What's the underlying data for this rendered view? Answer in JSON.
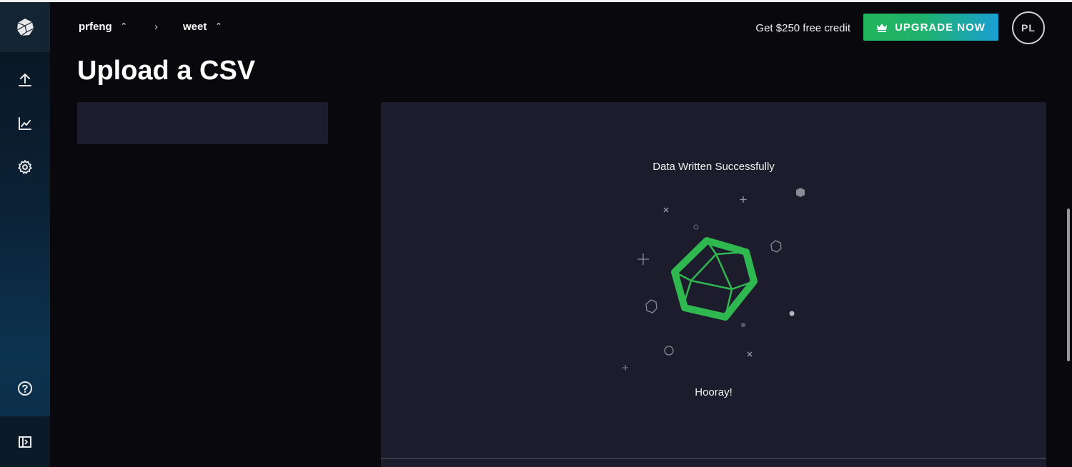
{
  "sidebar": {
    "logo_icon": "cube-logo-icon",
    "items": [
      {
        "name": "upload",
        "icon": "upload-icon"
      },
      {
        "name": "explore",
        "icon": "chart-icon"
      },
      {
        "name": "settings",
        "icon": "gear-icon"
      }
    ],
    "help_icon": "help-icon",
    "collapse_icon": "sidebar-expand-icon"
  },
  "header": {
    "org": "prfeng",
    "dataset": "weet",
    "credit_text": "Get $250 free credit",
    "upgrade_label": "UPGRADE NOW",
    "avatar_initials": "PL"
  },
  "page": {
    "title": "Upload a CSV"
  },
  "result": {
    "status": "Data Written Successfully",
    "message": "Hooray!",
    "accent_color": "#2fb84f"
  }
}
